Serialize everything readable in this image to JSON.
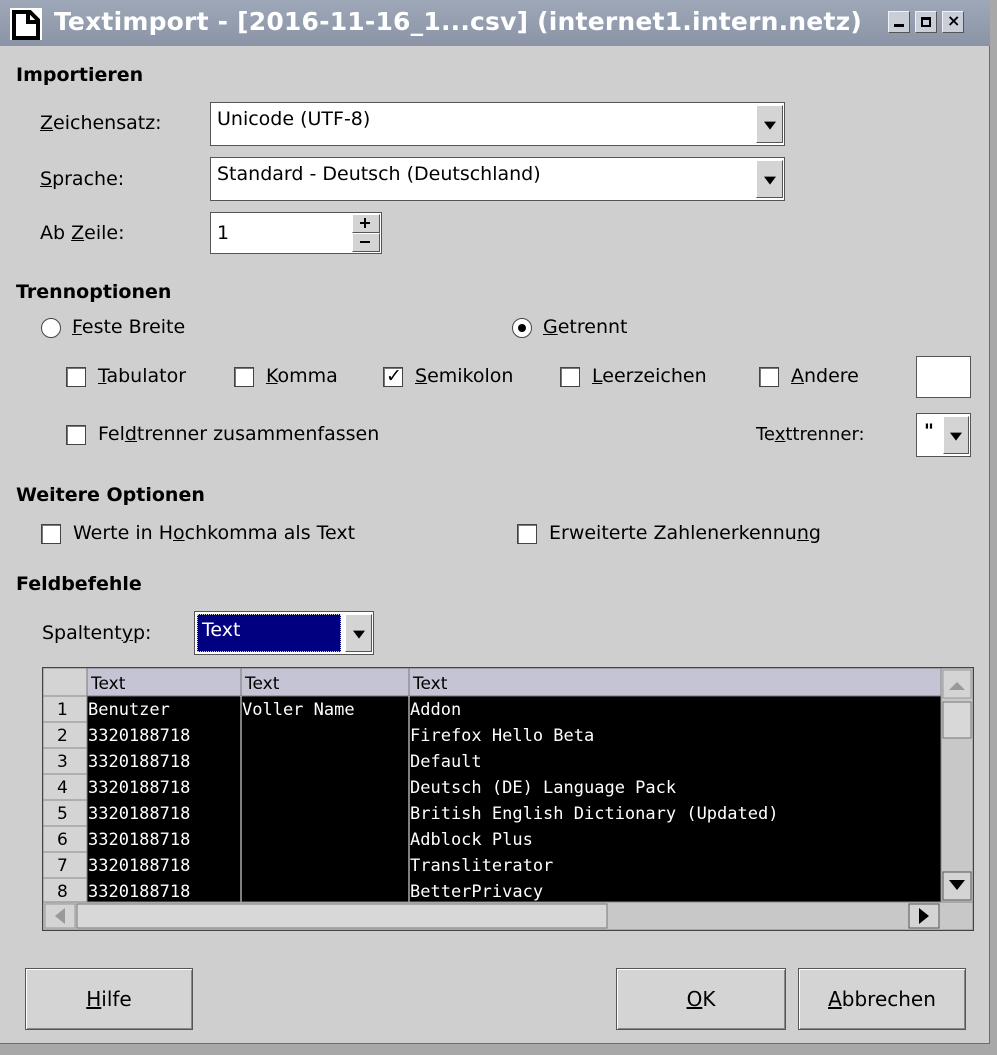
{
  "window": {
    "title": "Textimport - [2016-11-16_1...csv] (internet1.intern.netz)"
  },
  "import_section": {
    "heading": "Importieren",
    "charset_label_pre": "",
    "charset_label_u": "Z",
    "charset_label_post": "eichensatz:",
    "charset_value": "Unicode (UTF-8)",
    "language_label_u": "S",
    "language_label_post": "prache:",
    "language_value": "Standard - Deutsch (Deutschland)",
    "from_row_label_pre": "Ab ",
    "from_row_label_u": "Z",
    "from_row_label_post": "eile:",
    "from_row_value": "1"
  },
  "separator_section": {
    "heading": "Trennoptionen",
    "fixed_width_u": "F",
    "fixed_width_post": "este Breite",
    "separated_u": "G",
    "separated_post": "etrennt",
    "tab_u": "T",
    "tab_post": "abulator",
    "comma_u": "K",
    "comma_post": "omma",
    "semicolon_u": "S",
    "semicolon_post": "emikolon",
    "space_u": "L",
    "space_post": "eerzeichen",
    "other_u": "A",
    "other_post": "ndere",
    "merge_pre": "Fel",
    "merge_u": "d",
    "merge_post": "trenner zusammenfassen",
    "text_delim_pre": "Te",
    "text_delim_u": "x",
    "text_delim_post": "ttrenner:",
    "text_delim_value": "\"",
    "checked": {
      "tab": false,
      "comma": false,
      "semicolon": true,
      "space": false,
      "other": false,
      "merge": false
    },
    "mode": "separated"
  },
  "more_options": {
    "heading": "Weitere Optionen",
    "quoted_pre": "Werte in H",
    "quoted_u": "o",
    "quoted_post": "chkomma als Text",
    "detect_pre": "Erweiterte Zahlenerkennu",
    "detect_u": "n",
    "detect_post": "g"
  },
  "field_commands": {
    "heading": "Feldbefehle",
    "col_type_pre": "Spaltent",
    "col_type_u": "y",
    "col_type_post": "p:",
    "col_type_value": "Text"
  },
  "preview": {
    "column_types": [
      "Text",
      "Text",
      "Text"
    ],
    "row_numbers": [
      "1",
      "2",
      "3",
      "4",
      "5",
      "6",
      "7",
      "8"
    ],
    "rows": [
      [
        "Benutzer",
        "Voller Name",
        "Addon"
      ],
      [
        "3320188718",
        "",
        "Firefox Hello Beta"
      ],
      [
        "3320188718",
        "",
        "Default"
      ],
      [
        "3320188718",
        "",
        "Deutsch (DE) Language Pack"
      ],
      [
        "3320188718",
        "",
        "British English Dictionary (Updated)"
      ],
      [
        "3320188718",
        "",
        "Adblock Plus"
      ],
      [
        "3320188718",
        "",
        "Transliterator"
      ],
      [
        "3320188718",
        "",
        "BetterPrivacy"
      ]
    ]
  },
  "buttons": {
    "help_u": "H",
    "help_post": "ilfe",
    "ok_u": "O",
    "ok_post": "K",
    "cancel_u": "A",
    "cancel_post": "bbrechen"
  },
  "colors": {
    "titlebar": "#939dae",
    "dialog_bg": "#cfcfcf",
    "selection": "#000080",
    "grid_bg": "#000000",
    "grid_header": "#c0c0d0"
  }
}
